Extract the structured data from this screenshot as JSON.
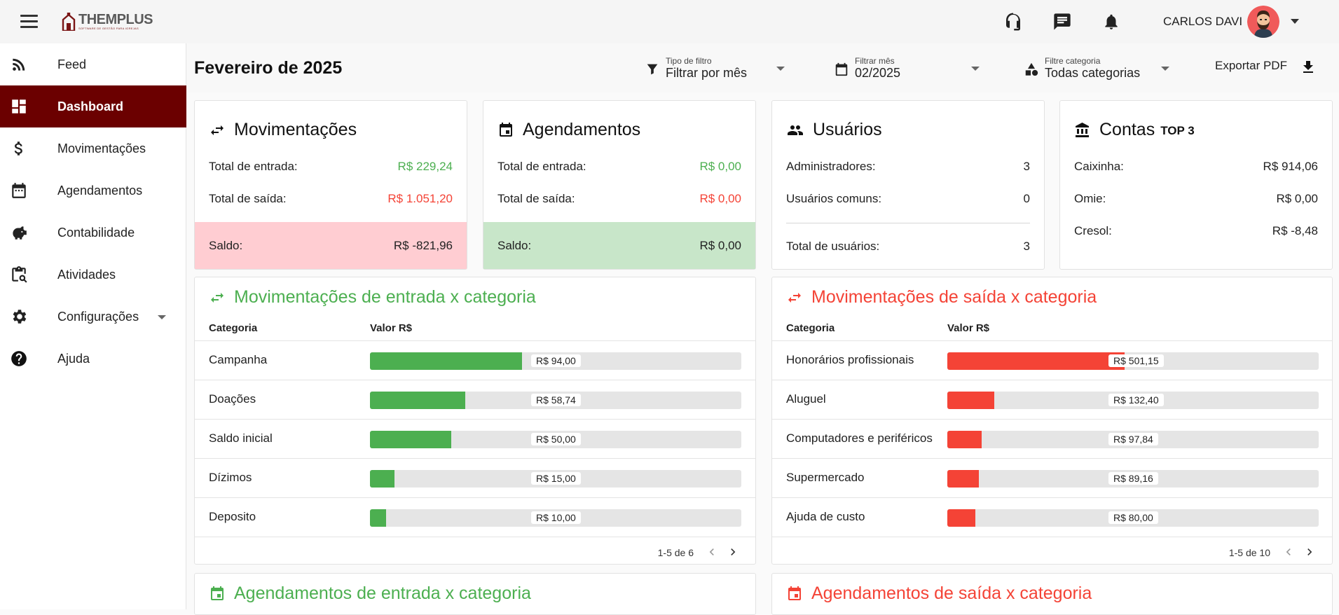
{
  "brand": {
    "logo_text": "THEMPLUS",
    "tagline": "SOFTWARE DE GESTÃO PARA IGREJAS"
  },
  "user": {
    "name": "CARLOS DAVI"
  },
  "sidebar": {
    "items": [
      {
        "label": "Feed",
        "icon": "rss-icon"
      },
      {
        "label": "Dashboard",
        "icon": "dashboard-icon",
        "active": true
      },
      {
        "label": "Movimentações",
        "icon": "dollar-icon"
      },
      {
        "label": "Agendamentos",
        "icon": "calendar-icon"
      },
      {
        "label": "Contabilidade",
        "icon": "piggy-bank-icon"
      },
      {
        "label": "Atividades",
        "icon": "clipboard-search-icon"
      },
      {
        "label": "Configurações",
        "icon": "gear-icon",
        "expandable": true
      },
      {
        "label": "Ajuda",
        "icon": "help-icon"
      }
    ]
  },
  "header": {
    "title": "Fevereiro de 2025",
    "filters": [
      {
        "label": "Tipo de filtro",
        "value": "Filtrar por mês",
        "icon": "filter-icon"
      },
      {
        "label": "Filtrar mês",
        "value": "02/2025",
        "icon": "calendar-icon"
      },
      {
        "label": "Filtre categoria",
        "value": "Todas categorias",
        "icon": "category-icon"
      }
    ],
    "export_label": "Exportar PDF"
  },
  "cards": {
    "movimentacoes": {
      "title": "Movimentações",
      "entrada_label": "Total de entrada:",
      "entrada_value": "R$ 229,24",
      "saida_label": "Total de saída:",
      "saida_value": "R$ 1.051,20",
      "saldo_label": "Saldo:",
      "saldo_value": "R$ -821,96"
    },
    "agendamentos": {
      "title": "Agendamentos",
      "entrada_label": "Total de entrada:",
      "entrada_value": "R$ 0,00",
      "saida_label": "Total de saída:",
      "saida_value": "R$ 0,00",
      "saldo_label": "Saldo:",
      "saldo_value": "R$ 0,00"
    },
    "usuarios": {
      "title": "Usuários",
      "admins_label": "Administradores:",
      "admins_value": "3",
      "comuns_label": "Usuários comuns:",
      "comuns_value": "0",
      "total_label": "Total de usuários:",
      "total_value": "3"
    },
    "contas": {
      "title": "Contas",
      "badge": "TOP 3",
      "rows": [
        {
          "label": "Caixinha:",
          "value": "R$ 914,06"
        },
        {
          "label": "Omie:",
          "value": "R$ 0,00"
        },
        {
          "label": "Cresol:",
          "value": "R$ -8,48"
        }
      ]
    }
  },
  "tables": {
    "entrada": {
      "title": "Movimentações de entrada x categoria",
      "col_categoria": "Categoria",
      "col_valor": "Valor R$",
      "color": "#4caf50",
      "rows": [
        {
          "category": "Campanha",
          "value": 94.0,
          "label": "R$ 94,00"
        },
        {
          "category": "Doações",
          "value": 58.74,
          "label": "R$ 58,74"
        },
        {
          "category": "Saldo inicial",
          "value": 50.0,
          "label": "R$ 50,00"
        },
        {
          "category": "Dízimos",
          "value": 15.0,
          "label": "R$ 15,00"
        },
        {
          "category": "Deposito",
          "value": 10.0,
          "label": "R$ 10,00"
        }
      ],
      "total": 229.24,
      "pagination": "1-5 de 6"
    },
    "saida": {
      "title": "Movimentações de saída x categoria",
      "col_categoria": "Categoria",
      "col_valor": "Valor R$",
      "color": "#f44336",
      "rows": [
        {
          "category": "Honorários profissionais",
          "value": 501.15,
          "label": "R$ 501,15"
        },
        {
          "category": "Aluguel",
          "value": 132.4,
          "label": "R$ 132,40"
        },
        {
          "category": "Computadores e periféricos",
          "value": 97.84,
          "label": "R$ 97,84"
        },
        {
          "category": "Supermercado",
          "value": 89.16,
          "label": "R$ 89,16"
        },
        {
          "category": "Ajuda de custo",
          "value": 80.0,
          "label": "R$ 80,00"
        }
      ],
      "total": 1051.2,
      "pagination": "1-5 de 10"
    }
  },
  "bottom": {
    "entrada_title": "Agendamentos de entrada x categoria",
    "saida_title": "Agendamentos de saída x categoria"
  },
  "colors": {
    "brand": "#6b0000",
    "green": "#4caf50",
    "red": "#f44336"
  }
}
